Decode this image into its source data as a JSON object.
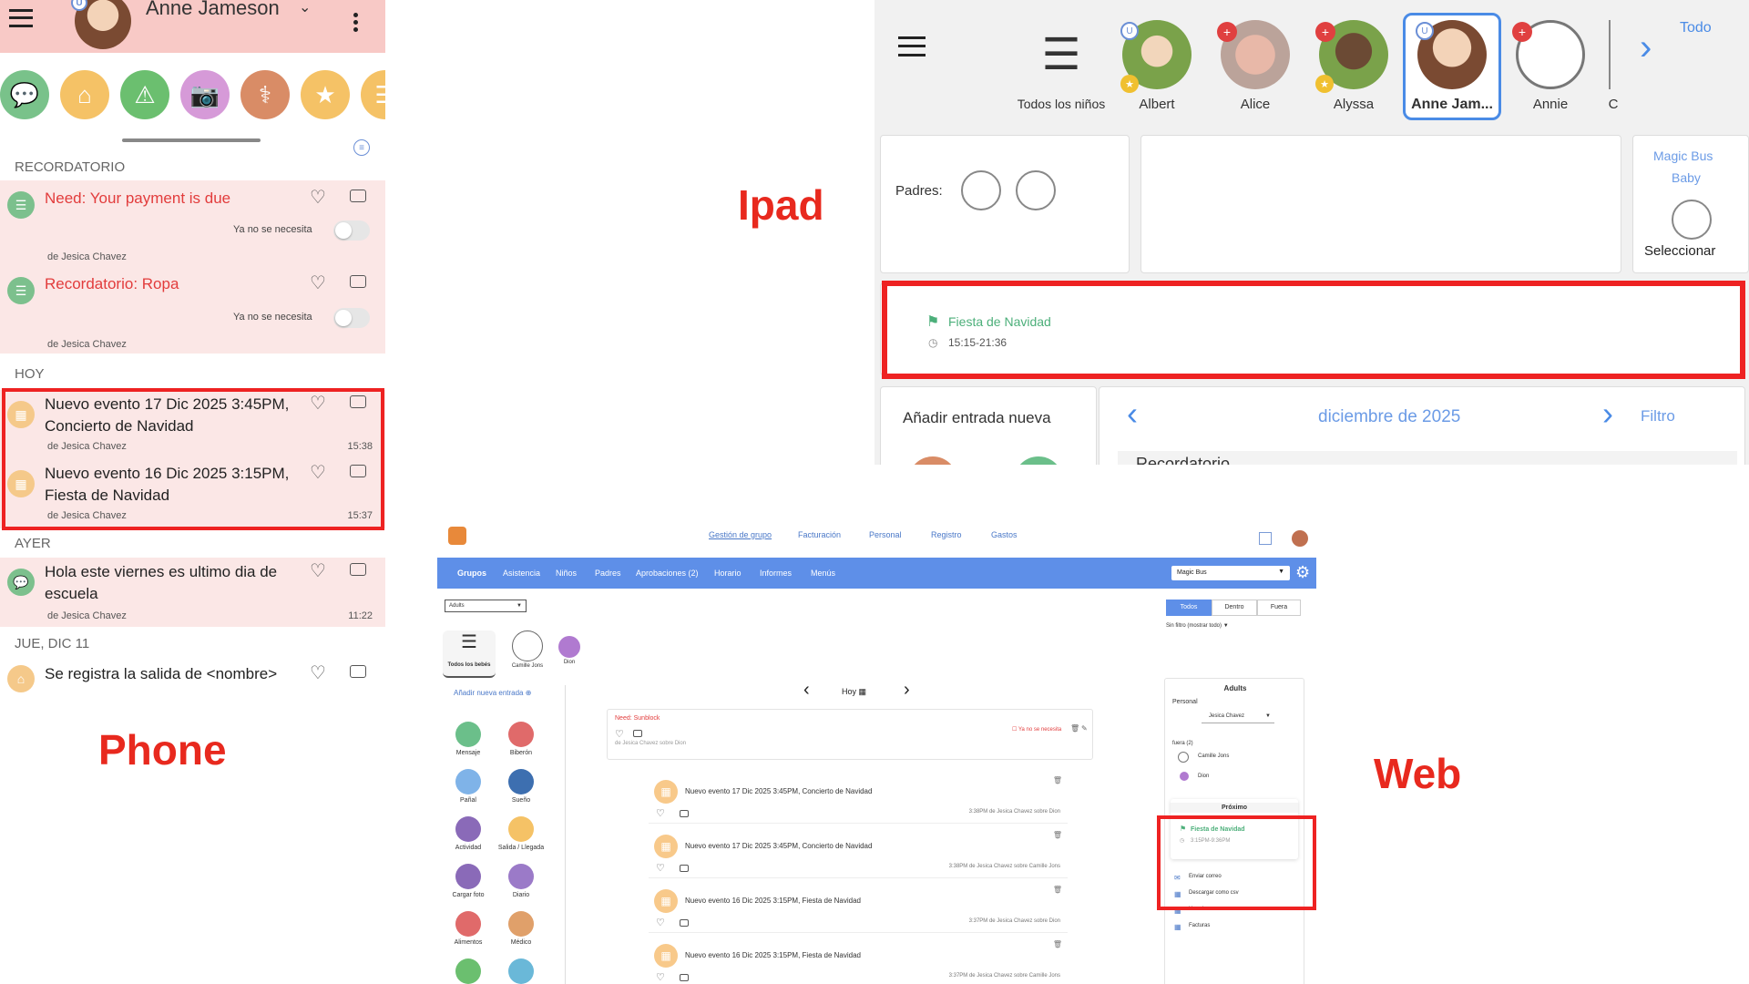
{
  "labels": {
    "phone": "Phone",
    "ipad": "Ipad",
    "web": "Web"
  },
  "colors": {
    "accent_red": "#e8291e",
    "phone_header": "#f8c9c6",
    "web_nav": "#5e8fe8",
    "ipad_blue": "#4a8be6",
    "event_green": "#4caf7a"
  },
  "phone": {
    "user_name": "Anne Jameson",
    "user_badge": "U",
    "actions": [
      {
        "name": "message",
        "icon": "chat-icon",
        "color": "#79c28a"
      },
      {
        "name": "check-in",
        "icon": "home-icon",
        "color": "#f5c266"
      },
      {
        "name": "alert",
        "icon": "warning-icon",
        "color": "#6bbf6f"
      },
      {
        "name": "photo",
        "icon": "camera-icon",
        "color": "#d69ad8"
      },
      {
        "name": "medical",
        "icon": "doctor-icon",
        "color": "#d98c66"
      },
      {
        "name": "favorite",
        "icon": "star-icon",
        "color": "#f5c266"
      },
      {
        "name": "note",
        "icon": "notes-icon",
        "color": "#f5c266"
      }
    ],
    "sections": {
      "reminder": "RECORDATORIO",
      "today": "HOY",
      "yesterday": "AYER",
      "thu": "JUE, DIC 11"
    },
    "items": {
      "r1_title": "Need: Your payment is due",
      "r1_toggle": "Ya no se necesita",
      "r1_from": "de Jesica Chavez",
      "r2_title": "Recordatorio: Ropa",
      "r2_toggle": "Ya no se necesita",
      "r2_from": "de Jesica Chavez",
      "t1_title": "Nuevo evento 17 Dic 2025 3:45PM, Concierto de Navidad",
      "t1_from": "de Jesica Chavez",
      "t1_time": "15:38",
      "t2_title": "Nuevo evento 16 Dic 2025 3:15PM, Fiesta de Navidad",
      "t2_from": "de Jesica Chavez",
      "t2_time": "15:37",
      "y1_title": "Hola este viernes es ultimo dia de escuela",
      "y1_from": "de Jesica Chavez",
      "y1_time": "11:22",
      "d1_title": "Se registra la salida de <nombre>"
    }
  },
  "ipad": {
    "all_kids": "Todos los niños",
    "kids": [
      "Albert",
      "Alice",
      "Alyssa",
      "Anne Jam...",
      "Annie",
      "C"
    ],
    "todo": "Todo",
    "parents_label": "Padres:",
    "room_line1": "Magic Bus",
    "room_line2": "Baby",
    "select": "Seleccionar",
    "event_title": "Fiesta de Navidad",
    "event_time": "15:15-21:36",
    "add_entry": "Añadir entrada nueva",
    "month": "diciembre de 2025",
    "filter": "Filtro",
    "section_peek": "Recordatorio"
  },
  "web": {
    "top_links": [
      "Gestión de grupo",
      "Facturación",
      "Personal",
      "Registro",
      "Gastos"
    ],
    "nav": [
      "Grupos",
      "Asistencia",
      "Niños",
      "Padres",
      "Aprobaciones (2)",
      "Horario",
      "Informes",
      "Menús"
    ],
    "group_select": "Magic Bus",
    "adults_select": "Adults",
    "seg": [
      "Todos",
      "Dentro",
      "Fuera"
    ],
    "filter_select": "Sin filtro (mostrar todo)",
    "kids": [
      "Todos los bebés",
      "Camille Jons",
      "Dion"
    ],
    "add_entry": "Añadir nueva entrada",
    "actions": [
      {
        "label": "Mensaje",
        "color": "#6bbf8a"
      },
      {
        "label": "Biberón",
        "color": "#e06a6a"
      },
      {
        "label": "Pañal",
        "color": "#7fb3e8"
      },
      {
        "label": "Sueño",
        "color": "#3d6fb0"
      },
      {
        "label": "Actividad",
        "color": "#8a6ab8"
      },
      {
        "label": "Salida / Llegada",
        "color": "#f5c266"
      },
      {
        "label": "Cargar foto",
        "color": "#8a6ab8"
      },
      {
        "label": "Diario",
        "color": "#9b7ac8"
      },
      {
        "label": "Alimentos",
        "color": "#e06a6a"
      },
      {
        "label": "Médico",
        "color": "#e0a06a"
      },
      {
        "label": "",
        "color": "#6bbf6f"
      },
      {
        "label": "",
        "color": "#6ab8d8"
      }
    ],
    "today": "Hoy",
    "need_title": "Need: Sunblock",
    "need_not_needed": "Ya no se necesita",
    "need_meta": "de Jesica Chavez sobre Dion",
    "feed": [
      {
        "title": "Nuevo evento 17 Dic 2025 3:45PM, Concierto de Navidad",
        "meta": "3:38PM de Jesica Chavez sobre Dion"
      },
      {
        "title": "Nuevo evento 17 Dic 2025 3:45PM, Concierto de Navidad",
        "meta": "3:38PM de Jesica Chavez sobre Camille Jons"
      },
      {
        "title": "Nuevo evento 16 Dic 2025 3:15PM, Fiesta de Navidad",
        "meta": "3:37PM de Jesica Chavez sobre Dion"
      },
      {
        "title": "Nuevo evento 16 Dic 2025 3:15PM, Fiesta de Navidad",
        "meta": "3:37PM de Jesica Chavez sobre Camille Jons"
      }
    ],
    "side": {
      "title": "Adults",
      "personal": "Personal",
      "staff": "Jesica Chavez",
      "out": "fuera (2)",
      "out_kids": [
        "Camille Jons",
        "Dion"
      ],
      "upcoming": "Próximo",
      "event_title": "Fiesta de Navidad",
      "event_time": "3:15PM-9:36PM",
      "links": [
        "Enviar correo",
        "Descargar como csv",
        "Horario",
        "Facturas"
      ]
    }
  }
}
